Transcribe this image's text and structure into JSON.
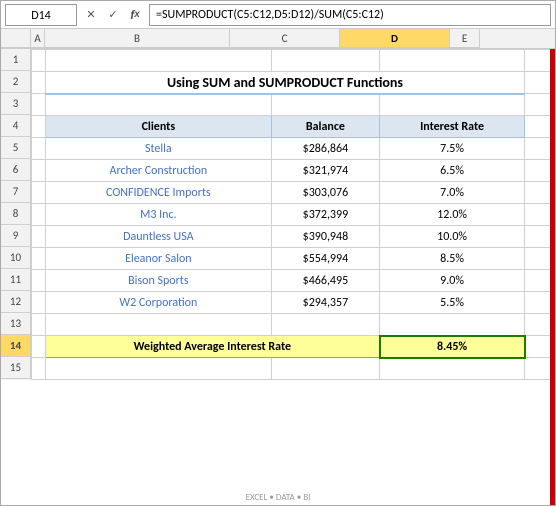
{
  "namebox": {
    "value": "D14"
  },
  "formula": {
    "text": "=SUMPRODUCT(C5:C12,D5:D12)/SUM(C5:C12)"
  },
  "columns": {
    "a_label": "",
    "b_label": "B",
    "c_label": "C",
    "d_label": "D",
    "e_label": "E"
  },
  "title": "Using SUM and SUMPRODUCT Functions",
  "headers": {
    "clients": "Clients",
    "balance": "Balance",
    "interest_rate": "Interest Rate"
  },
  "rows": [
    {
      "client": "Stella",
      "balance": "$286,864",
      "rate": "7.5%"
    },
    {
      "client": "Archer Construction",
      "balance": "$321,974",
      "rate": "6.5%"
    },
    {
      "client": "CONFIDENCE Imports",
      "balance": "$303,076",
      "rate": "7.0%"
    },
    {
      "client": "M3 Inc.",
      "balance": "$372,399",
      "rate": "12.0%"
    },
    {
      "client": "Dauntless USA",
      "balance": "$390,948",
      "rate": "10.0%"
    },
    {
      "client": "Eleanor Salon",
      "balance": "$554,994",
      "rate": "8.5%"
    },
    {
      "client": "Bison Sports",
      "balance": "$466,495",
      "rate": "9.0%"
    },
    {
      "client": "W2 Corporation",
      "balance": "$294,357",
      "rate": "5.5%"
    }
  ],
  "result": {
    "label": "Weighted Average Interest Rate",
    "value": "8.45%"
  },
  "watermark": "EXCEL • DATA • BI",
  "row_numbers": [
    "1",
    "2",
    "3",
    "4",
    "5",
    "6",
    "7",
    "8",
    "9",
    "10",
    "11",
    "12",
    "13",
    "14",
    "15"
  ]
}
